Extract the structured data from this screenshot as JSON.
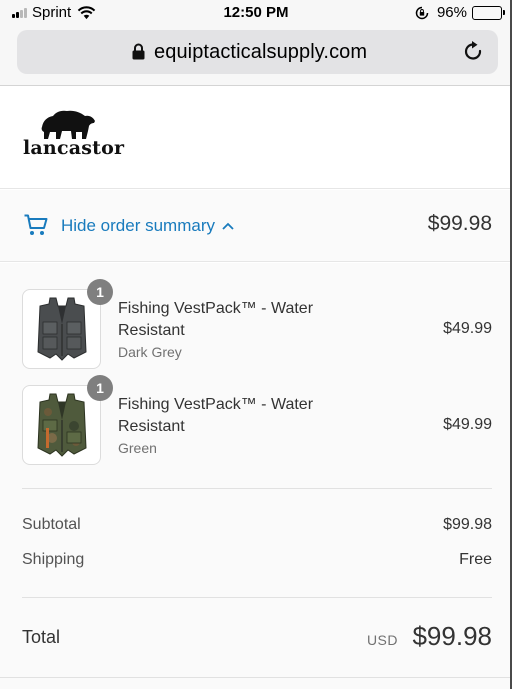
{
  "status_bar": {
    "carrier": "Sprint",
    "time": "12:50 PM",
    "battery": "96%"
  },
  "browser": {
    "url": "equiptacticalsupply.com",
    "icons": [
      "lock-icon",
      "reload-icon"
    ]
  },
  "store": {
    "brand": "lancastor",
    "logo_icon": "bear-icon"
  },
  "summary_toggle": {
    "label": "Hide order summary",
    "total": "$99.98",
    "accent_color": "#197bbd"
  },
  "line_items": [
    {
      "quantity": "1",
      "name": "Fishing VestPack™ - Water Resistant",
      "variant": "Dark Grey",
      "price": "$49.99"
    },
    {
      "quantity": "1",
      "name": "Fishing VestPack™ - Water Resistant",
      "variant": "Green",
      "price": "$49.99"
    }
  ],
  "costs": {
    "subtotal_label": "Subtotal",
    "subtotal_value": "$99.98",
    "shipping_label": "Shipping",
    "shipping_value": "Free"
  },
  "total": {
    "label": "Total",
    "currency": "USD",
    "amount": "$99.98"
  }
}
